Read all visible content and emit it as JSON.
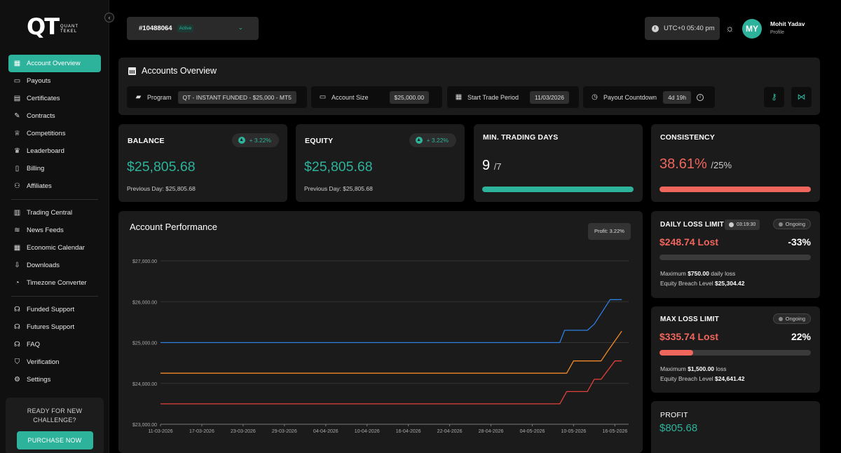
{
  "brand": {
    "mark": "QT",
    "name_line1": "QUANT",
    "name_line2": "TEKEL"
  },
  "sidebar": {
    "items": [
      {
        "label": "Account Overview",
        "icon": "grid-icon",
        "glyph": "▦",
        "active": true
      },
      {
        "label": "Payouts",
        "icon": "cash-icon",
        "glyph": "▭"
      },
      {
        "label": "Certificates",
        "icon": "certificate-icon",
        "glyph": "▤"
      },
      {
        "label": "Contracts",
        "icon": "contract-icon",
        "glyph": "✎"
      },
      {
        "label": "Competitions",
        "icon": "trophy-icon",
        "glyph": "♕"
      },
      {
        "label": "Leaderboard",
        "icon": "medal-icon",
        "glyph": "♛"
      },
      {
        "label": "Billing",
        "icon": "invoice-icon",
        "glyph": "▯"
      },
      {
        "label": "Affiliates",
        "icon": "users-icon",
        "glyph": "⚇"
      },
      {
        "separator": true
      },
      {
        "label": "Trading Central",
        "icon": "chart-icon",
        "glyph": "▥"
      },
      {
        "label": "News Feeds",
        "icon": "rss-icon",
        "glyph": "≋"
      },
      {
        "label": "Economic Calendar",
        "icon": "calendar-icon",
        "glyph": "▦"
      },
      {
        "label": "Downloads",
        "icon": "download-icon",
        "glyph": "⇩"
      },
      {
        "label": "Timezone Converter",
        "icon": "clock-icon",
        "glyph": "◔"
      },
      {
        "separator": true
      },
      {
        "label": "Funded Support",
        "icon": "headset-icon",
        "glyph": "☊"
      },
      {
        "label": "Futures Support",
        "icon": "headset-icon",
        "glyph": "☊"
      },
      {
        "label": "FAQ",
        "icon": "faq-icon",
        "glyph": "☊"
      },
      {
        "label": "Verification",
        "icon": "shield-icon",
        "glyph": "⛉"
      },
      {
        "label": "Settings",
        "icon": "gear-icon",
        "glyph": "⚙"
      }
    ],
    "promo_text_line1": "READY FOR NEW",
    "promo_text_line2": "CHALLENGE?",
    "promo_button": "PURCHASE NOW"
  },
  "header": {
    "account_id": "#10488064",
    "account_status": "Active",
    "time": "UTC+0 05:40 pm",
    "avatar_initials": "MY",
    "user_name": "Mohit Yadav",
    "user_sub": "Profile"
  },
  "overview": {
    "title": "Accounts Overview",
    "program_label": "Program",
    "program_value": "QT - INSTANT FUNDED - $25,000 - MT5",
    "size_label": "Account Size",
    "size_value": "$25,000.00",
    "start_label": "Start Trade Period",
    "start_value": "11/03/2026",
    "payout_label": "Payout Countdown",
    "payout_value": "4d 19h"
  },
  "balance": {
    "title": "BALANCE",
    "change": "+ 3.22%",
    "value": "$25,805.68",
    "previous": "Previous Day: $25,805.68"
  },
  "equity": {
    "title": "EQUITY",
    "change": "+ 3.22%",
    "value": "$25,805.68",
    "previous": "Previous Day: $25,805.68"
  },
  "min_days": {
    "title": "MIN. TRADING DAYS",
    "value": "9",
    "of": "/7",
    "progress": 1.0,
    "color": "#2db39b"
  },
  "consistency": {
    "title": "CONSISTENCY",
    "value": "38.61%",
    "of": "/25%",
    "progress": 1.0,
    "color": "#f0665c"
  },
  "daily_loss": {
    "title": "DAILY LOSS LIMIT",
    "timer": "03:19:30",
    "status": "Ongoing",
    "lost": "$248.74 Lost",
    "pct": "-33%",
    "progress": 0.0,
    "line1_pre": "Maximum ",
    "line1_val": "$750.00",
    "line1_post": " daily loss",
    "line2_pre": "Equity Breach Level ",
    "line2_val": "$25,304.42"
  },
  "max_loss": {
    "title": "MAX LOSS LIMIT",
    "status": "Ongoing",
    "lost": "$335.74 Lost",
    "pct": "22%",
    "progress": 0.22,
    "line1_pre": "Maximum ",
    "line1_val": "$1,500.00",
    "line1_post": " loss",
    "line2_pre": "Equity Breach Level ",
    "line2_val": "$24,641.42"
  },
  "profit": {
    "title": "PROFIT",
    "value": "$805.68"
  },
  "chart_data": {
    "type": "line",
    "title": "Account Performance",
    "badge": "Profit: 3.22%",
    "ylim": [
      23000,
      27000
    ],
    "yticks": [
      "$23,000.00",
      "$24,000.00",
      "$25,000.00",
      "$26,000.00",
      "$27,000.00"
    ],
    "ytick_values": [
      23000,
      24000,
      25000,
      26000,
      27000
    ],
    "xlim": [
      0,
      68
    ],
    "xticks": [
      "11-03-2026",
      "17-03-2026",
      "23-03-2026",
      "29-03-2026",
      "04-04-2026",
      "10-04-2026",
      "16-04-2026",
      "22-04-2026",
      "28-04-2026",
      "04-05-2026",
      "10-05-2026",
      "16-05-2026"
    ],
    "xtick_values": [
      0,
      6,
      12,
      18,
      24,
      30,
      36,
      42,
      48,
      54,
      60,
      66
    ],
    "grid": true,
    "series": [
      {
        "color": "#2f7fe0",
        "points": [
          [
            0,
            25000
          ],
          [
            58,
            25000
          ],
          [
            58.7,
            25300
          ],
          [
            62,
            25300
          ],
          [
            63,
            25450
          ],
          [
            65.3,
            26050
          ],
          [
            67,
            26050
          ]
        ]
      },
      {
        "color": "#f08a2a",
        "points": [
          [
            0,
            24250
          ],
          [
            59,
            24250
          ],
          [
            60,
            24550
          ],
          [
            64,
            24550
          ],
          [
            65,
            24800
          ],
          [
            67,
            25280
          ]
        ]
      },
      {
        "color": "#e2413a",
        "points": [
          [
            0,
            23500
          ],
          [
            58,
            23500
          ],
          [
            59,
            23800
          ],
          [
            62,
            23800
          ],
          [
            63,
            24100
          ],
          [
            64,
            24100
          ],
          [
            66,
            24550
          ],
          [
            67,
            24550
          ]
        ]
      }
    ]
  }
}
